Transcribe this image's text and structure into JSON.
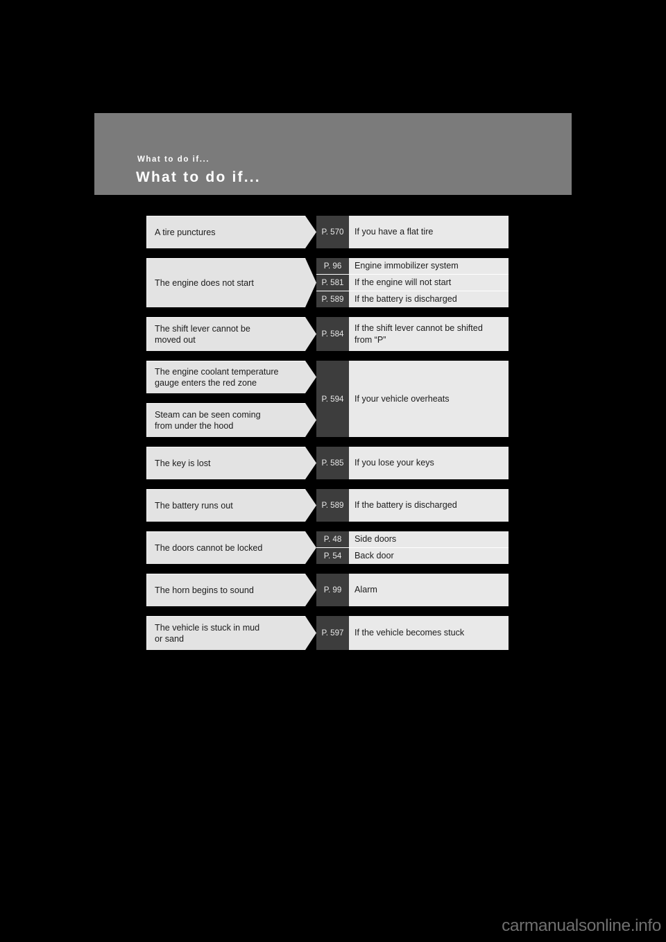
{
  "header": {
    "kicker": "What to do if...",
    "title": "What to do if...",
    "band_color": "#7b7b7b"
  },
  "colors": {
    "page_background": "#000000",
    "condition_box": "#e3e3e3",
    "page_ref_box": "#3d3d3d",
    "description_box": "#e9e9e9",
    "text": "#1b1b1b",
    "ref_text": "#e8e8e8",
    "watermark": "#6f6f6f"
  },
  "flow": {
    "rows": [
      {
        "conditions": [
          "A tire punctures"
        ],
        "references": [
          {
            "page": "P. 570",
            "text": "If you have a flat tire"
          }
        ]
      },
      {
        "conditions": [
          "The engine does not start"
        ],
        "references": [
          {
            "page": "P. 96",
            "text": "Engine immobilizer system"
          },
          {
            "page": "P. 581",
            "text": "If the engine will not start"
          },
          {
            "page": "P. 589",
            "text": "If the battery is discharged"
          }
        ]
      },
      {
        "conditions": [
          "The shift lever cannot be\nmoved out"
        ],
        "references": [
          {
            "page": "P. 584",
            "text": "If the shift lever cannot be shifted\nfrom “P”"
          }
        ]
      },
      {
        "conditions": [
          "The engine coolant temperature\ngauge enters the red zone",
          "Steam can be seen coming\nfrom under the hood"
        ],
        "references": [
          {
            "page": "P. 594",
            "text": "If your vehicle overheats"
          }
        ]
      },
      {
        "conditions": [
          "The key is lost"
        ],
        "references": [
          {
            "page": "P. 585",
            "text": "If you lose your keys"
          }
        ]
      },
      {
        "conditions": [
          "The battery runs out"
        ],
        "references": [
          {
            "page": "P. 589",
            "text": "If the battery is discharged"
          }
        ]
      },
      {
        "conditions": [
          "The doors cannot be locked"
        ],
        "references": [
          {
            "page": "P. 48",
            "text": "Side doors"
          },
          {
            "page": "P. 54",
            "text": "Back door"
          }
        ]
      },
      {
        "conditions": [
          "The horn begins to sound"
        ],
        "references": [
          {
            "page": "P. 99",
            "text": "Alarm"
          }
        ]
      },
      {
        "conditions": [
          "The vehicle is stuck in mud\nor sand"
        ],
        "references": [
          {
            "page": "P. 597",
            "text": "If the vehicle becomes stuck"
          }
        ]
      }
    ]
  },
  "watermark": {
    "text": "carmanualsonline.info"
  }
}
